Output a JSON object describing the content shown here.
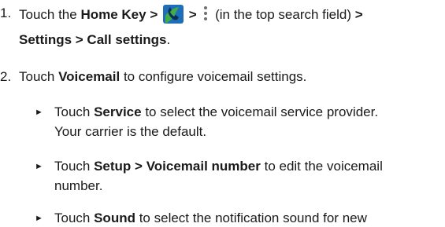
{
  "steps": [
    {
      "number": "1.",
      "line1": {
        "t1": "Touch the ",
        "b1": "Home Key >",
        "sep1": " ",
        "sep2": " > ",
        "sep3": " ",
        "t2": "(in the top search field) ",
        "b2": ">"
      },
      "line2": {
        "b1": "Settings > Call settings",
        "t1": "."
      }
    },
    {
      "number": "2.",
      "line1": {
        "t1": "Touch ",
        "b1": "Voicemail",
        "t2": " to configure voicemail settings."
      }
    }
  ],
  "subitems": [
    {
      "bullet": "►",
      "line1": {
        "t1": "Touch ",
        "b1": "Service",
        "t2": " to select the voicemail service provider."
      },
      "line2": "Your carrier is the default."
    },
    {
      "bullet": "►",
      "line1": {
        "t1": "Touch ",
        "b1": "Setup > Voicemail number",
        "t2": " to edit the voicemail"
      },
      "line2": "number."
    },
    {
      "bullet": "►",
      "line1": {
        "t1": "Touch ",
        "b1": "Sound",
        "t2": " to select the notification sound for new"
      }
    }
  ],
  "icons": {
    "phone": "phone-app-icon",
    "menu": "more-options-icon",
    "phone_colors": {
      "bg": "#1f6fb8",
      "leaf": "#3fae49",
      "handset": "#0c2f57"
    },
    "menu_color": "#6f6f6f"
  }
}
